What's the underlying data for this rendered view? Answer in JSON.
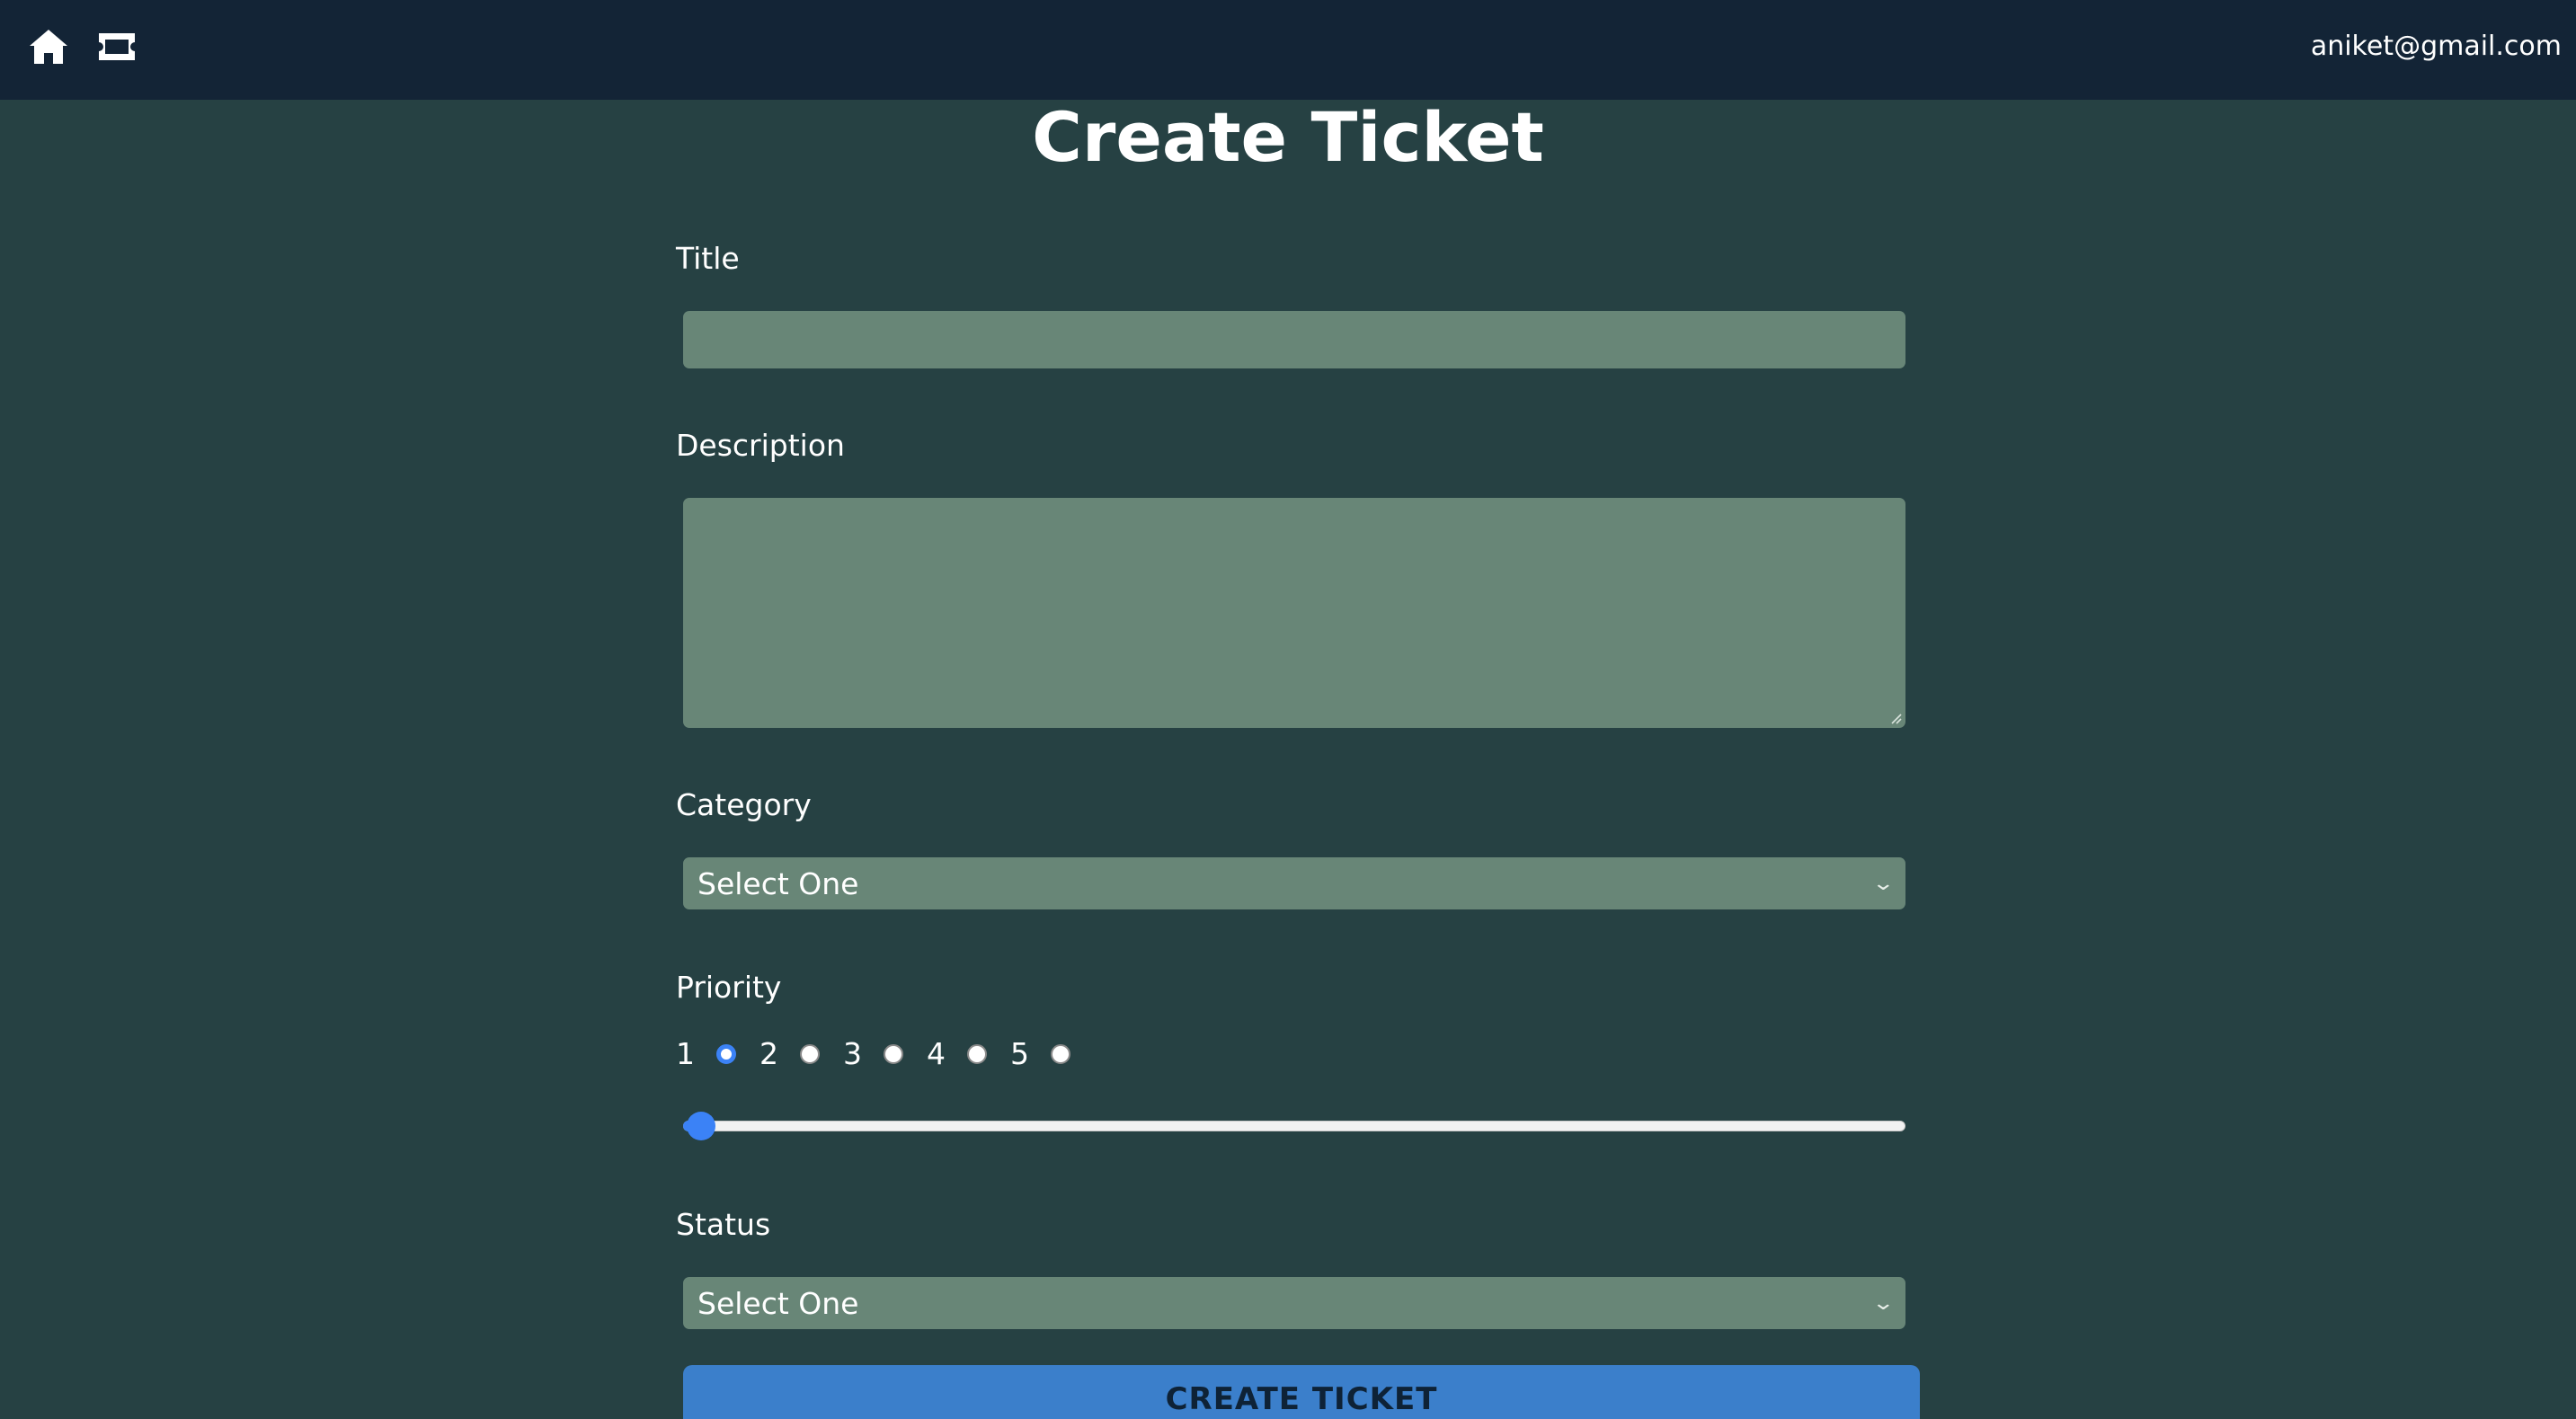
{
  "header": {
    "home_icon": "home-icon",
    "tickets_icon": "ticket-icon",
    "user_email": "aniket@gmail.com"
  },
  "page": {
    "title": "Create Ticket"
  },
  "form": {
    "title_label": "Title",
    "title_value": "",
    "description_label": "Description",
    "description_value": "",
    "category_label": "Category",
    "category_selected": "Select One",
    "priority_label": "Priority",
    "priority_options": [
      "1",
      "2",
      "3",
      "4",
      "5"
    ],
    "priority_selected": "1",
    "priority_slider_value": 0,
    "status_label": "Status",
    "status_selected": "Select One",
    "submit_label": "CREATE TICKET"
  },
  "colors": {
    "background": "#264143",
    "topbar": "#132436",
    "field": "#688677",
    "accent": "#3b82f6",
    "button": "#3b7fcb"
  }
}
